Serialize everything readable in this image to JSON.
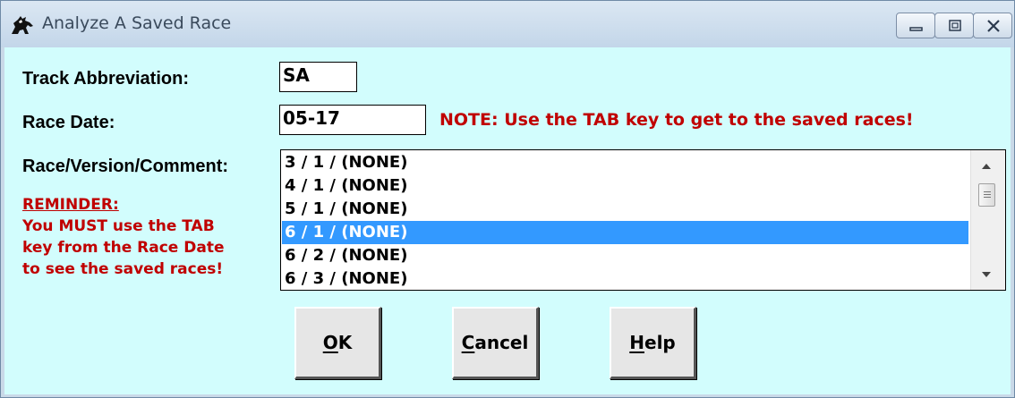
{
  "window": {
    "title": "Analyze A Saved Race",
    "controls": [
      "minimize-icon",
      "restore-icon",
      "close-icon"
    ]
  },
  "form": {
    "track_label": "Track Abbreviation:",
    "track_value": "SA",
    "date_label": "Race Date:",
    "date_value": "05-17",
    "note": "NOTE: Use the TAB key to get to the saved races!",
    "list_label": "Race/Version/Comment:",
    "reminder_title": "REMINDER:",
    "reminder_lines": [
      "You MUST use the TAB",
      "key from the Race Date",
      "to see the saved races!"
    ]
  },
  "races": [
    {
      "text": "3 / 1 / (NONE)",
      "selected": false
    },
    {
      "text": "4 / 1 / (NONE)",
      "selected": false
    },
    {
      "text": "5 / 1 / (NONE)",
      "selected": false
    },
    {
      "text": "6 / 1 / (NONE)",
      "selected": true
    },
    {
      "text": "6 / 2 / (NONE)",
      "selected": false
    },
    {
      "text": "6 / 3 / (NONE)",
      "selected": false
    }
  ],
  "buttons": {
    "ok_mnemonic": "O",
    "ok_rest": "K",
    "cancel_mnemonic": "C",
    "cancel_rest": "ancel",
    "help_mnemonic": "H",
    "help_rest": "elp"
  },
  "colors": {
    "client_bg": "#d2fdfd",
    "warning_text": "#c00000",
    "selection": "#3399ff"
  }
}
